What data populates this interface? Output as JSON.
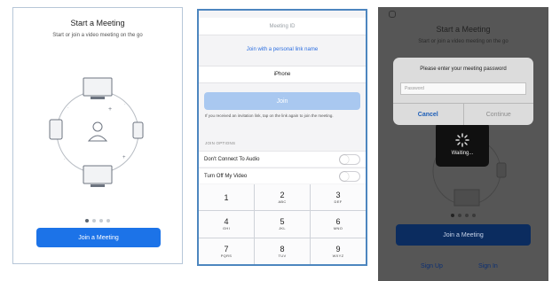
{
  "panel1": {
    "title": "Start a Meeting",
    "subtitle": "Start or join a video meeting on the go",
    "join_button": "Join a Meeting",
    "page_dots": 4,
    "active_dot": 0
  },
  "panel2": {
    "meeting_id_placeholder": "Meeting ID",
    "link_name": "Join with a personal link name",
    "device_name": "iPhone",
    "join_button": "Join",
    "invite_note": "If you received an invitation link, tap on the link again to join the meeting.",
    "options_header": "JOIN OPTIONS",
    "options": [
      {
        "label": "Don't Connect To Audio",
        "on": false
      },
      {
        "label": "Turn Off My Video",
        "on": false
      }
    ],
    "keypad": [
      {
        "num": "1",
        "letters": ""
      },
      {
        "num": "2",
        "letters": "ABC"
      },
      {
        "num": "3",
        "letters": "DEF"
      },
      {
        "num": "4",
        "letters": "GHI"
      },
      {
        "num": "5",
        "letters": "JKL"
      },
      {
        "num": "6",
        "letters": "MNO"
      },
      {
        "num": "7",
        "letters": "PQRS"
      },
      {
        "num": "8",
        "letters": "TUV"
      },
      {
        "num": "9",
        "letters": "WXYZ"
      }
    ]
  },
  "panel3": {
    "title": "Start a Meeting",
    "subtitle": "Start or join a video meeting on the go",
    "dialog_message": "Please enter your meeting password",
    "password_placeholder": "Password",
    "cancel": "Cancel",
    "continue": "Continue",
    "waiting": "Waiting...",
    "join_button": "Join a Meeting",
    "sign_up": "Sign Up",
    "sign_in": "Sign In"
  },
  "colors": {
    "accent": "#1c73e8",
    "join_disabled": "#a9c8f0",
    "link": "#2d6fe0",
    "dim_overlay": "#565656"
  }
}
